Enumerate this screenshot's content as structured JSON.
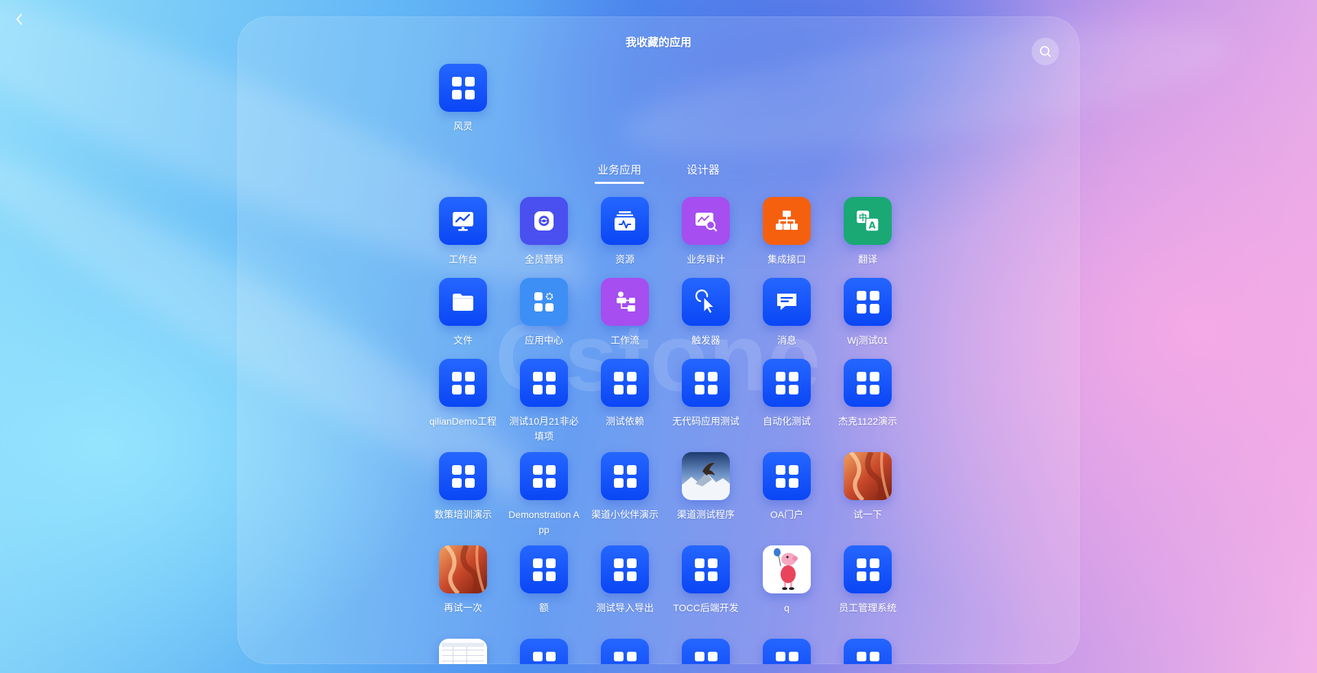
{
  "header": {
    "back_icon": "chevron-left-icon",
    "title": "我收藏的应用",
    "search_icon": "search-icon"
  },
  "favorites": [
    {
      "label": "风灵",
      "icon": "grid-icon"
    }
  ],
  "tabs": [
    {
      "label": "业务应用",
      "active": true
    },
    {
      "label": "设计器",
      "active": false
    }
  ],
  "apps": [
    {
      "label": "工作台",
      "icon": "monitor-chart-icon",
      "color": "#0a46f5"
    },
    {
      "label": "全员营销",
      "icon": "marketing-icon",
      "color": "#4a4ff0"
    },
    {
      "label": "资源",
      "icon": "resource-icon",
      "color": "#0a46f5"
    },
    {
      "label": "业务审计",
      "icon": "audit-icon",
      "color": "#a64ef0"
    },
    {
      "label": "集成接口",
      "icon": "integration-icon",
      "color": "#f5600e"
    },
    {
      "label": "翻译",
      "icon": "translate-icon",
      "color": "#1aa875"
    },
    {
      "label": "文件",
      "icon": "folder-icon",
      "color": "#0a46f5"
    },
    {
      "label": "应用中心",
      "icon": "app-center-icon",
      "color": "#3d8ff5"
    },
    {
      "label": "工作流",
      "icon": "workflow-icon",
      "color": "#a64ef0"
    },
    {
      "label": "触发器",
      "icon": "trigger-cursor-icon",
      "color": "#0a46f5"
    },
    {
      "label": "消息",
      "icon": "message-icon",
      "color": "#0a46f5"
    },
    {
      "label": "Wj测试01",
      "icon": "grid-icon",
      "color": "#0a46f5"
    },
    {
      "label": "qilianDemo工程",
      "icon": "grid-icon",
      "color": "#0a46f5"
    },
    {
      "label": "测试10月21非必填项",
      "icon": "grid-icon",
      "color": "#0a46f5"
    },
    {
      "label": "测试依赖",
      "icon": "grid-icon",
      "color": "#0a46f5"
    },
    {
      "label": "无代码应用测试",
      "icon": "grid-icon",
      "color": "#0a46f5"
    },
    {
      "label": "自动化测试",
      "icon": "grid-icon",
      "color": "#0a46f5"
    },
    {
      "label": "杰克1122演示",
      "icon": "grid-icon",
      "color": "#0a46f5"
    },
    {
      "label": "数策培训演示",
      "icon": "grid-icon",
      "color": "#0a46f5"
    },
    {
      "label": "Demonstration App",
      "icon": "grid-icon",
      "color": "#0a46f5"
    },
    {
      "label": "渠道小伙伴演示",
      "icon": "grid-icon",
      "color": "#0a46f5"
    },
    {
      "label": "渠道测试程序",
      "icon": "eagle-photo-icon",
      "color": "#3a5a8a"
    },
    {
      "label": "OA门户",
      "icon": "grid-icon",
      "color": "#0a46f5"
    },
    {
      "label": "试一下",
      "icon": "canyon-photo-icon",
      "color": "#d0552a"
    },
    {
      "label": "再试一次",
      "icon": "canyon-photo-icon",
      "color": "#d0552a"
    },
    {
      "label": "额",
      "icon": "grid-icon",
      "color": "#0a46f5"
    },
    {
      "label": "测试导入导出",
      "icon": "grid-icon",
      "color": "#0a46f5"
    },
    {
      "label": "TOCC后端开发",
      "icon": "grid-icon",
      "color": "#0a46f5"
    },
    {
      "label": "q",
      "icon": "peppa-pig-icon",
      "color": "#ffffff"
    },
    {
      "label": "员工管理系统",
      "icon": "grid-icon",
      "color": "#0a46f5"
    },
    {
      "label": "",
      "icon": "document-thumbnail-icon",
      "color": "#ffffff"
    },
    {
      "label": "",
      "icon": "grid-icon",
      "color": "#0a46f5"
    },
    {
      "label": "",
      "icon": "grid-icon",
      "color": "#0a46f5"
    },
    {
      "label": "",
      "icon": "grid-icon",
      "color": "#0a46f5"
    },
    {
      "label": "",
      "icon": "grid-icon",
      "color": "#0a46f5"
    },
    {
      "label": "",
      "icon": "grid-icon",
      "color": "#0a46f5"
    }
  ],
  "watermark_text": "Cstone"
}
